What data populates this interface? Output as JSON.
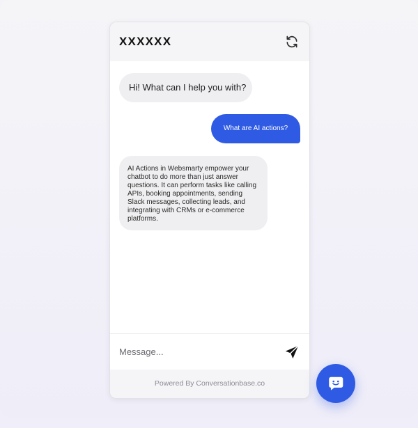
{
  "header": {
    "title": "XXXXXX",
    "refresh_icon": "refresh-icon"
  },
  "messages": [
    {
      "role": "bot",
      "text": "Hi! What can I help you with?"
    },
    {
      "role": "user",
      "text": "What are AI actions?"
    },
    {
      "role": "bot",
      "text": "AI Actions in Websmarty empower your chatbot to do more than just answer questions. It can perform tasks like calling APIs, booking appointments, sending Slack messages, collecting leads, and integrating with CRMs or e-commerce platforms."
    }
  ],
  "composer": {
    "placeholder": "Message...",
    "send_icon": "send-icon"
  },
  "footer": {
    "text": "Powered By Conversationbase.co"
  },
  "launcher": {
    "icon": "chat-smile-icon"
  },
  "colors": {
    "accent": "#2f5be4",
    "bot_bubble": "#efeff1",
    "header_bg": "#f5f5f7"
  }
}
